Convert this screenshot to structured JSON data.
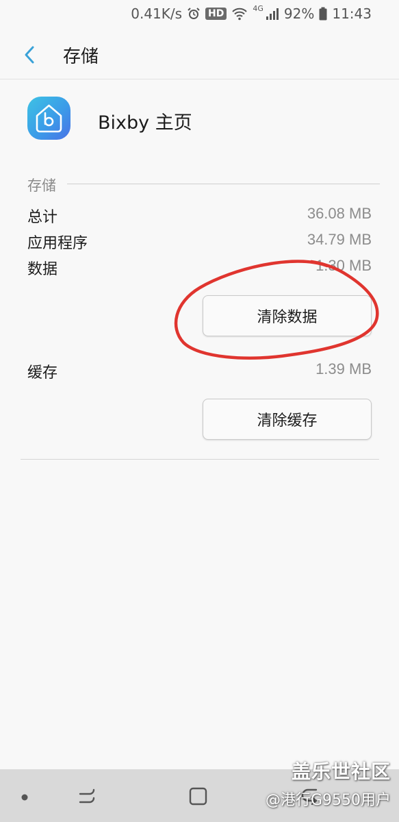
{
  "status_bar": {
    "net_speed": "0.41K/s",
    "hd_badge": "HD",
    "network_type": "4G",
    "battery": "92%",
    "time": "11:43",
    "icons": [
      "alarm-icon",
      "wifi-icon",
      "signal-icon",
      "battery-icon"
    ]
  },
  "app_bar": {
    "back_icon": "chevron-left-icon",
    "title": "存储"
  },
  "app": {
    "name": "Bixby 主页",
    "icon": "bixby-home-icon",
    "icon_colors": [
      "#3ec2e4",
      "#3b9ce8",
      "#4a72e6"
    ]
  },
  "storage": {
    "section_title": "存储",
    "rows": [
      {
        "label": "总计",
        "value": "36.08 MB"
      },
      {
        "label": "应用程序",
        "value": "34.79 MB"
      },
      {
        "label": "数据",
        "value": "1.30 MB"
      }
    ],
    "clear_data_label": "清除数据",
    "cache_label": "缓存",
    "cache_value": "1.39 MB",
    "clear_cache_label": "清除缓存"
  },
  "annotation": {
    "color": "#e0352f",
    "marks": "clear-data-button"
  },
  "nav_bar": {
    "items": [
      "dot-icon",
      "recents-icon",
      "home-icon",
      "back-icon"
    ]
  },
  "watermark": {
    "line1": "盖乐世社区",
    "line2": "@港行G9550用户"
  },
  "colors": {
    "background": "#f8f8f8",
    "accent": "#3aa2d8",
    "secondary_text": "#8c8c8c",
    "nav_bar": "#d9d9d9"
  }
}
